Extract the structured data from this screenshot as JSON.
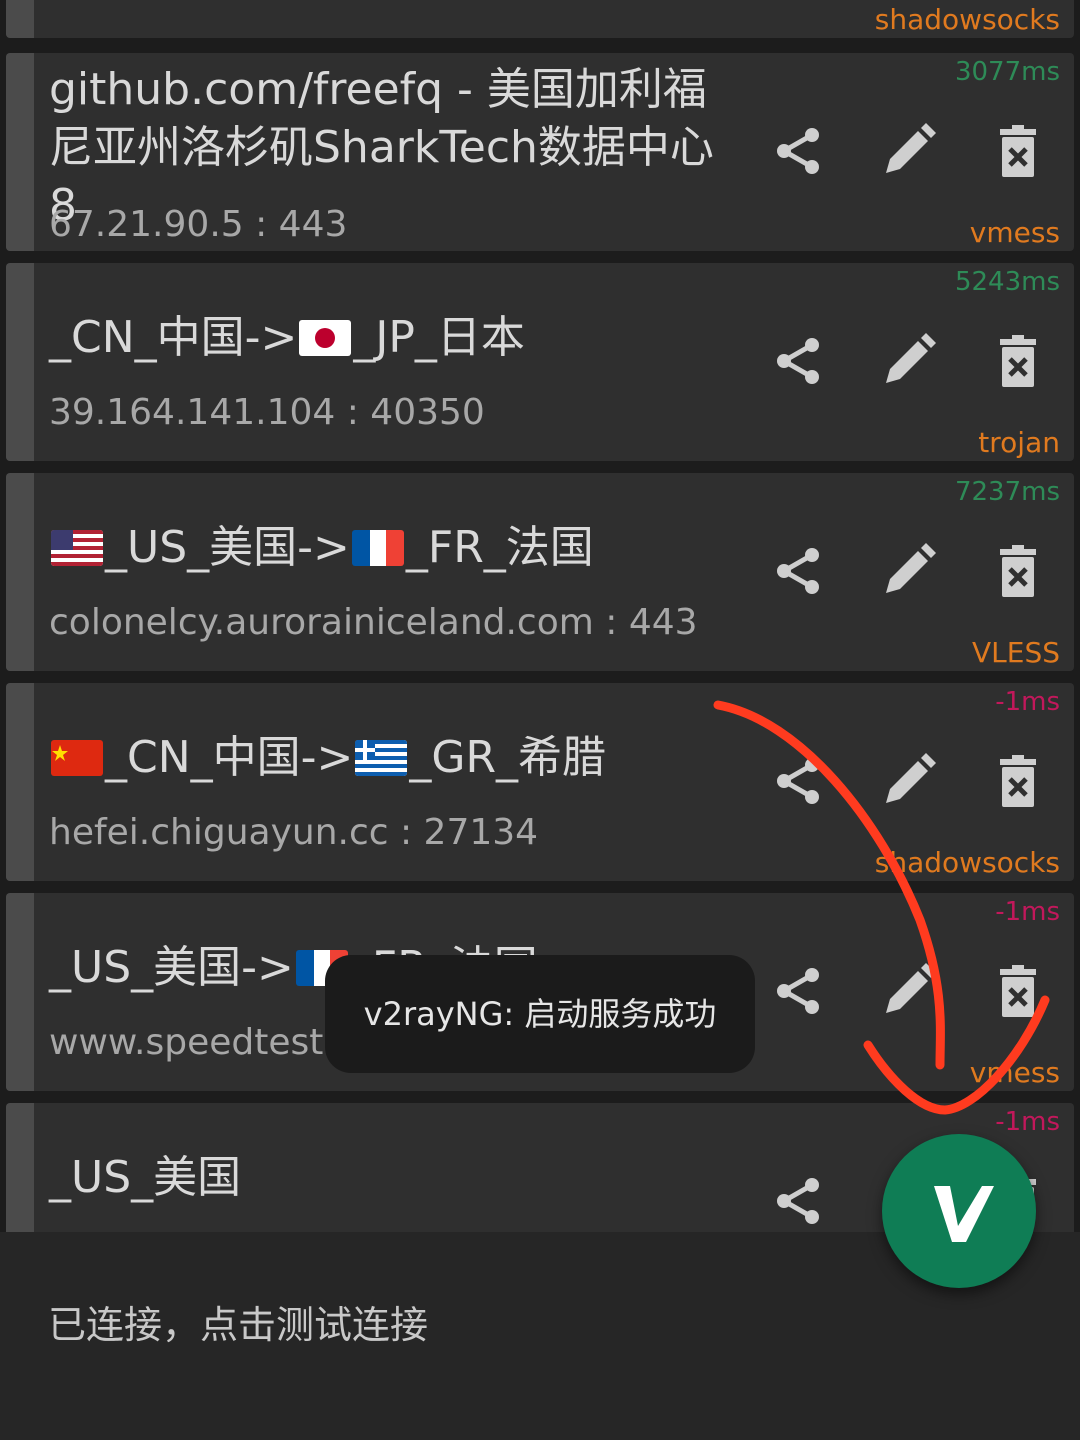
{
  "servers": [
    {
      "name": "",
      "address": "",
      "latency": "",
      "protocol": "shadowsocks"
    },
    {
      "name": "github.com/freefq - 美国加利福尼亚州洛杉矶SharkTech数据中心 8",
      "address": "67.21.90.5 : 443",
      "latency": "3077ms",
      "protocol": "vmess"
    },
    {
      "name_parts": [
        "_CN_中国->",
        "_JP_日本"
      ],
      "flags": [
        "jp"
      ],
      "address": "39.164.141.104 : 40350",
      "latency": "5243ms",
      "protocol": "trojan"
    },
    {
      "name_parts": [
        "_US_美国->",
        "_FR_法国"
      ],
      "flags": [
        "us",
        "fr"
      ],
      "address": "colonelcy.aurorainiceland.com : 443",
      "latency": "7237ms",
      "protocol": "VLESS"
    },
    {
      "name_parts": [
        "_CN_中国->",
        "_GR_希腊"
      ],
      "flags": [
        "cn",
        "gr"
      ],
      "address": "hefei.chiguayun.cc : 27134",
      "latency": "-1ms",
      "protocol": "shadowsocks"
    },
    {
      "name_parts": [
        "_US_美国->",
        "_FR_法国"
      ],
      "flags": [
        "fr"
      ],
      "address": "www.speedtest",
      "latency": "-1ms",
      "protocol": "vmess"
    },
    {
      "name": "_US_美国",
      "address": "",
      "latency": "-1ms",
      "protocol": ""
    }
  ],
  "icons": {
    "share": "share-icon",
    "edit": "edit-icon",
    "delete": "delete-icon",
    "fab": "v2rayng-logo-icon"
  },
  "toast": {
    "text": "v2rayNG: 启动服务成功"
  },
  "status_bar": {
    "text": "已连接，点击测试连接"
  },
  "colors": {
    "card_bg": "#2f2f2f",
    "latency_ok": "#2e8b57",
    "latency_fail": "#c2185b",
    "protocol": "#e07a1f",
    "fab": "#0f7d55",
    "annotation": "#ff3b1f"
  }
}
